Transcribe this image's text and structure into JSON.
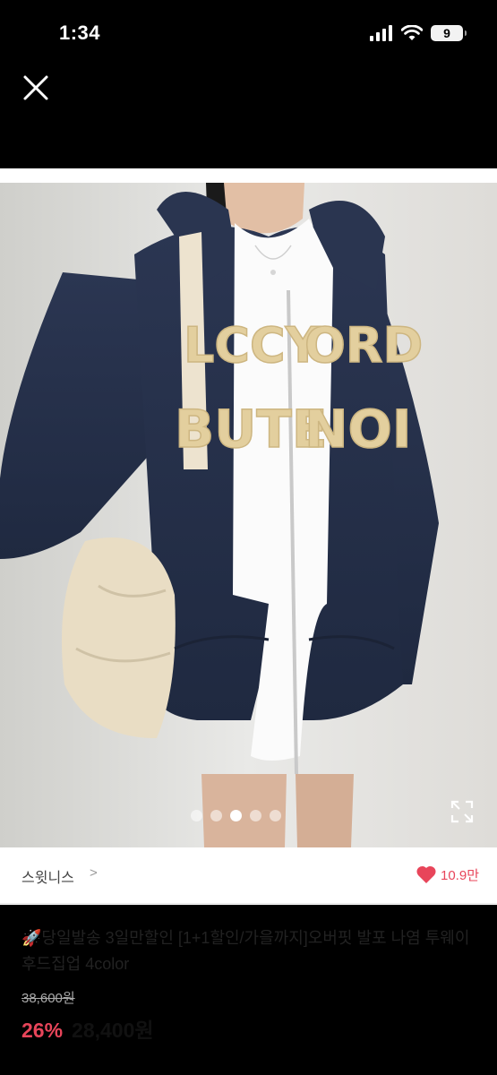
{
  "status_bar": {
    "time": "1:34",
    "battery": "9"
  },
  "seller": {
    "name": "스윗니스",
    "chevron": ">",
    "likes": "10.9만"
  },
  "product": {
    "title": "🚀당일발송 3일만할인 [1+1할인/가을까지]오버핏 발포 나염 투웨이 후드집업 4color",
    "original_price": "38,600원",
    "discount": "26%",
    "price": "28,400원"
  },
  "carousel": {
    "count": 5,
    "active_index": 2
  },
  "image": {
    "description": "navy zip-up hoodie with cream puff-print lettering",
    "print_lines": [
      "LCCY ORD",
      "BUTE NOI"
    ]
  },
  "colors": {
    "accent": "#e8455a",
    "hoodie": "#25304a",
    "print": "#e3cf9e"
  }
}
